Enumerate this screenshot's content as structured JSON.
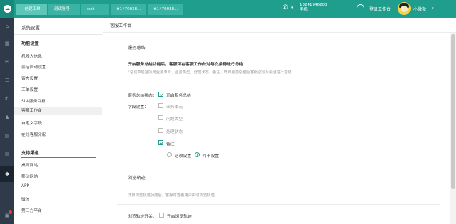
{
  "topbar": {
    "tabs": [
      {
        "label": "+创建工单",
        "active": true
      },
      {
        "label": "测试账号",
        "active": false
      },
      {
        "label": "test",
        "active": false
      },
      {
        "label": "#1470038...",
        "active": false
      },
      {
        "label": "#1470038...",
        "active": false
      }
    ],
    "phone_number": "13241946203",
    "phone_type": "手机",
    "login_workspace": "登录工作台",
    "username": "小微微",
    "accent_color": "#1f9e8e"
  },
  "rail_icons": [
    "home-icon",
    "grid-icon",
    "mail-icon",
    "list-icon",
    "phone-icon",
    "person-icon",
    "doc-icon",
    "chart-icon",
    "settings-icon",
    "notification-icon"
  ],
  "sidebar": {
    "title": "系统设置",
    "groups": [
      {
        "title": "功能设置",
        "items": [
          "机器人信息",
          "会话自动设置",
          "留言设置",
          "工单设置",
          "SLA服务目标",
          "客服工作台",
          "自定义字段",
          "在线客服分配"
        ]
      },
      {
        "title": "支持渠道",
        "items": [
          "桌面网站",
          "移动网站",
          "APP",
          "微信",
          "第三方平台"
        ]
      }
    ],
    "selected": "客服工作台"
  },
  "breadcrumb": "客服工作台",
  "service_summary": {
    "title": "服务总结",
    "subtitle": "开启服务总结功能后，客服可在客服工作台对每次接待进行总结",
    "hint": "*总结项包括所属业务单元、业务类型、处理状态、备注，开启服务总结后客服必须对会话进行总结",
    "status_label": "服务总结状态：",
    "status_checkbox_label": "开启服务总结",
    "fields_label": "字段设置：",
    "fields": [
      {
        "label": "业务单元",
        "checked": false
      },
      {
        "label": "问题类型",
        "checked": false
      },
      {
        "label": "处理状态",
        "checked": false
      },
      {
        "label": "备注",
        "checked": true
      }
    ],
    "radio_options": [
      {
        "label": "必须设置",
        "selected": false
      },
      {
        "label": "可不设置",
        "selected": true
      }
    ]
  },
  "browse_track": {
    "title": "浏览轨迹",
    "hint": "开启浏览轨迹功能后，客服可查看用户实时浏览轨迹",
    "switch_label": "浏览轨迹开关：",
    "checkbox_label": "开启浏览轨迹"
  }
}
